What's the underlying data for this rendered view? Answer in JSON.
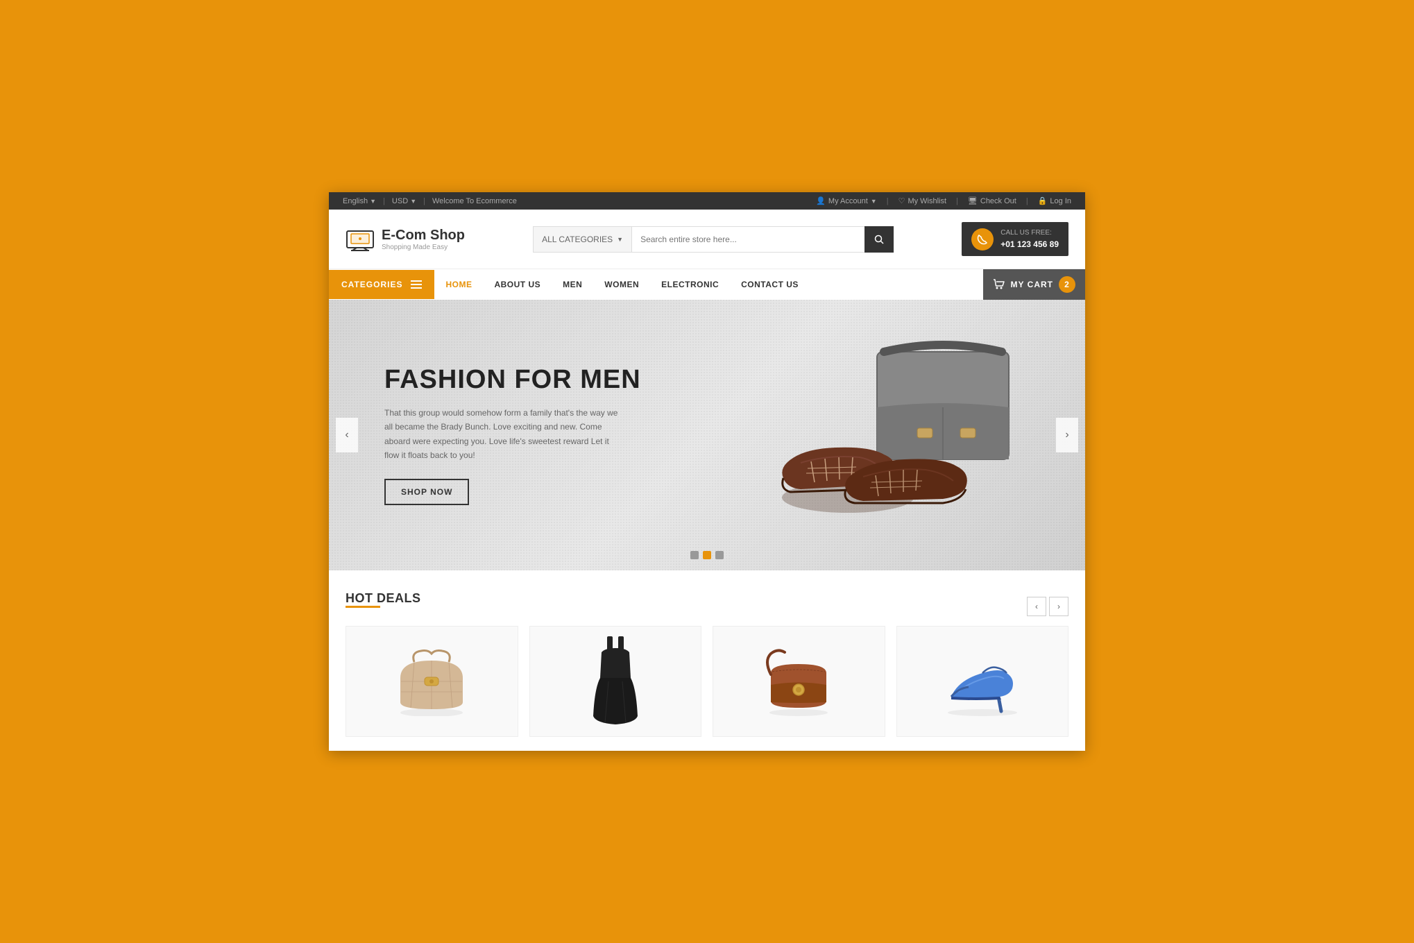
{
  "topbar": {
    "language_label": "English",
    "currency_label": "USD",
    "welcome_text": "Welcome To Ecommerce",
    "my_account": "My Account",
    "my_wishlist": "My Wishlist",
    "checkout": "Check Out",
    "login": "Log In"
  },
  "header": {
    "logo_name": "E-Com Shop",
    "logo_tagline": "Shopping Made Easy",
    "search_category": "ALL CATEGORIES",
    "search_placeholder": "Search entire store here...",
    "call_label": "CALL US FREE:",
    "call_number": "+01 123 456 89"
  },
  "nav": {
    "categories": "CATEGORIES",
    "links": [
      {
        "label": "HOME",
        "active": true
      },
      {
        "label": "ABOUT US",
        "active": false
      },
      {
        "label": "MEN",
        "active": false
      },
      {
        "label": "WOMEN",
        "active": false
      },
      {
        "label": "ELECTRONIC",
        "active": false
      },
      {
        "label": "CONTACT US",
        "active": false
      }
    ],
    "cart_label": "MY CART",
    "cart_count": "2"
  },
  "slider": {
    "title": "FASHION FOR MEN",
    "description": "That this group would somehow form a family that's the way we all became the Brady Bunch. Love exciting and new. Come aboard were expecting you. Love life's sweetest reward Let it flow it floats back to you!",
    "cta": "SHOP NOW",
    "dots": [
      {
        "state": "inactive"
      },
      {
        "state": "active"
      },
      {
        "state": "inactive"
      }
    ]
  },
  "hot_deals": {
    "title": "HOT DEALS",
    "products": [
      {
        "id": 1,
        "type": "handbag-beige"
      },
      {
        "id": 2,
        "type": "dress-black"
      },
      {
        "id": 3,
        "type": "handbag-brown"
      },
      {
        "id": 4,
        "type": "heels-blue"
      }
    ]
  }
}
